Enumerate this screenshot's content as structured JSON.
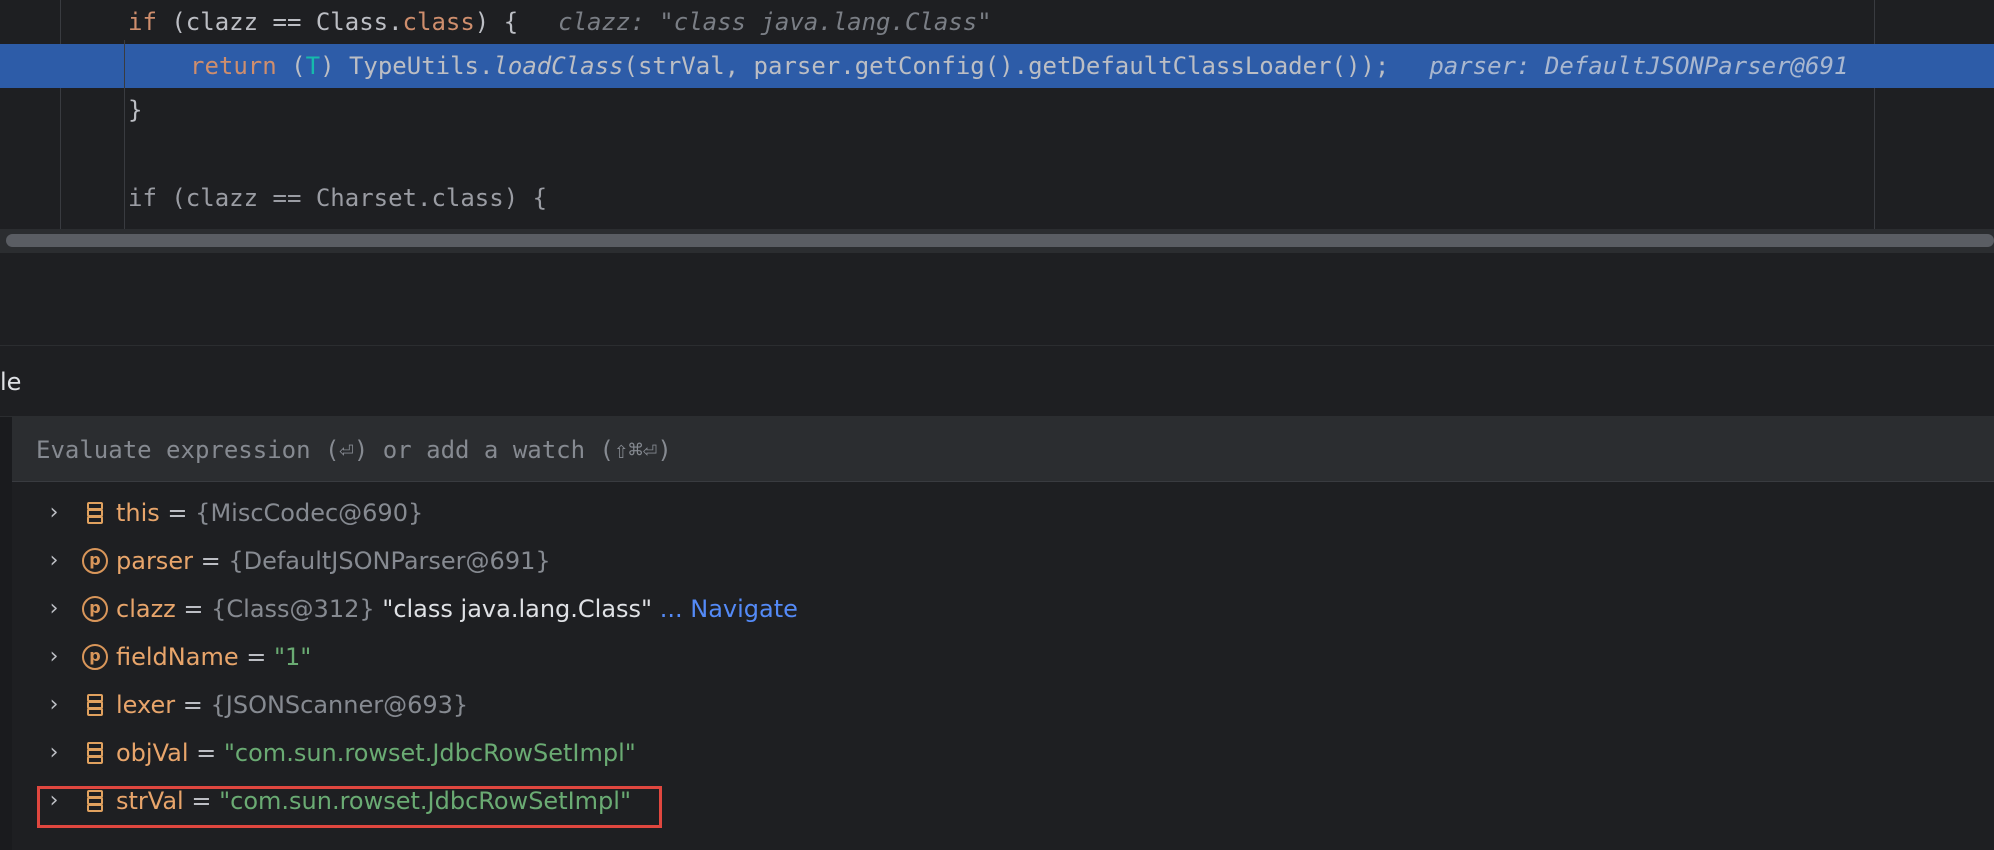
{
  "editor": {
    "lines": [
      {
        "tokens": [
          {
            "t": "if",
            "c": "kw"
          },
          {
            "t": " (clazz == Class.",
            "c": ""
          },
          {
            "t": "class",
            "c": "kw"
          },
          {
            "t": ") {",
            "c": ""
          }
        ],
        "hint": "clazz: \"class java.lang.Class\""
      },
      {
        "tokens": [
          {
            "t": "return",
            "c": "kw"
          },
          {
            "t": " (",
            "c": ""
          },
          {
            "t": "T",
            "c": "tp"
          },
          {
            "t": ") TypeUtils.",
            "c": ""
          },
          {
            "t": "loadClass",
            "c": "it"
          },
          {
            "t": "(strVal, parser.getConfig().getDefaultClassLoader());",
            "c": ""
          }
        ],
        "hint": "parser: DefaultJSONParser@691"
      },
      {
        "tokens": [
          {
            "t": "}",
            "c": ""
          }
        ],
        "hint": ""
      },
      {
        "tokens": [
          {
            "t": "if",
            "c": "kw dim"
          },
          {
            "t": " (clazz == Charset.",
            "c": "dim"
          },
          {
            "t": "class",
            "c": "kw dim"
          },
          {
            "t": ") {",
            "c": "dim"
          }
        ],
        "hint": ""
      }
    ]
  },
  "panel": {
    "tab_label": "le"
  },
  "eval": {
    "placeholder": "Evaluate expression (⏎) or add a watch (⇧⌘⏎)"
  },
  "variables": [
    {
      "icon": "field",
      "name": "this",
      "ref": "{MiscCodec@690}",
      "value": "",
      "value_style": "",
      "link": ""
    },
    {
      "icon": "param",
      "name": "parser",
      "ref": "{DefaultJSONParser@691}",
      "value": "",
      "value_style": "",
      "link": ""
    },
    {
      "icon": "param",
      "name": "clazz",
      "ref": "{Class@312}",
      "value": "\"class java.lang.Class\"",
      "value_style": "vstrw",
      "link": "... Navigate"
    },
    {
      "icon": "param",
      "name": "fieldName",
      "ref": "",
      "value": "\"1\"",
      "value_style": "vstr",
      "link": ""
    },
    {
      "icon": "field",
      "name": "lexer",
      "ref": "{JSONScanner@693}",
      "value": "",
      "value_style": "",
      "link": ""
    },
    {
      "icon": "field",
      "name": "objVal",
      "ref": "",
      "value": "\"com.sun.rowset.JdbcRowSetImpl\"",
      "value_style": "vstr",
      "link": ""
    },
    {
      "icon": "field",
      "name": "strVal",
      "ref": "",
      "value": "\"com.sun.rowset.JdbcRowSetImpl\"",
      "value_style": "vstr",
      "link": ""
    }
  ],
  "colors": {
    "background": "#1e1f22",
    "selection": "#2d5ca8",
    "keyword": "#cf8e6d",
    "string": "#6aab73",
    "variable_name": "#e8a56b",
    "link": "#548af7",
    "highlight_box": "#e0473f"
  }
}
